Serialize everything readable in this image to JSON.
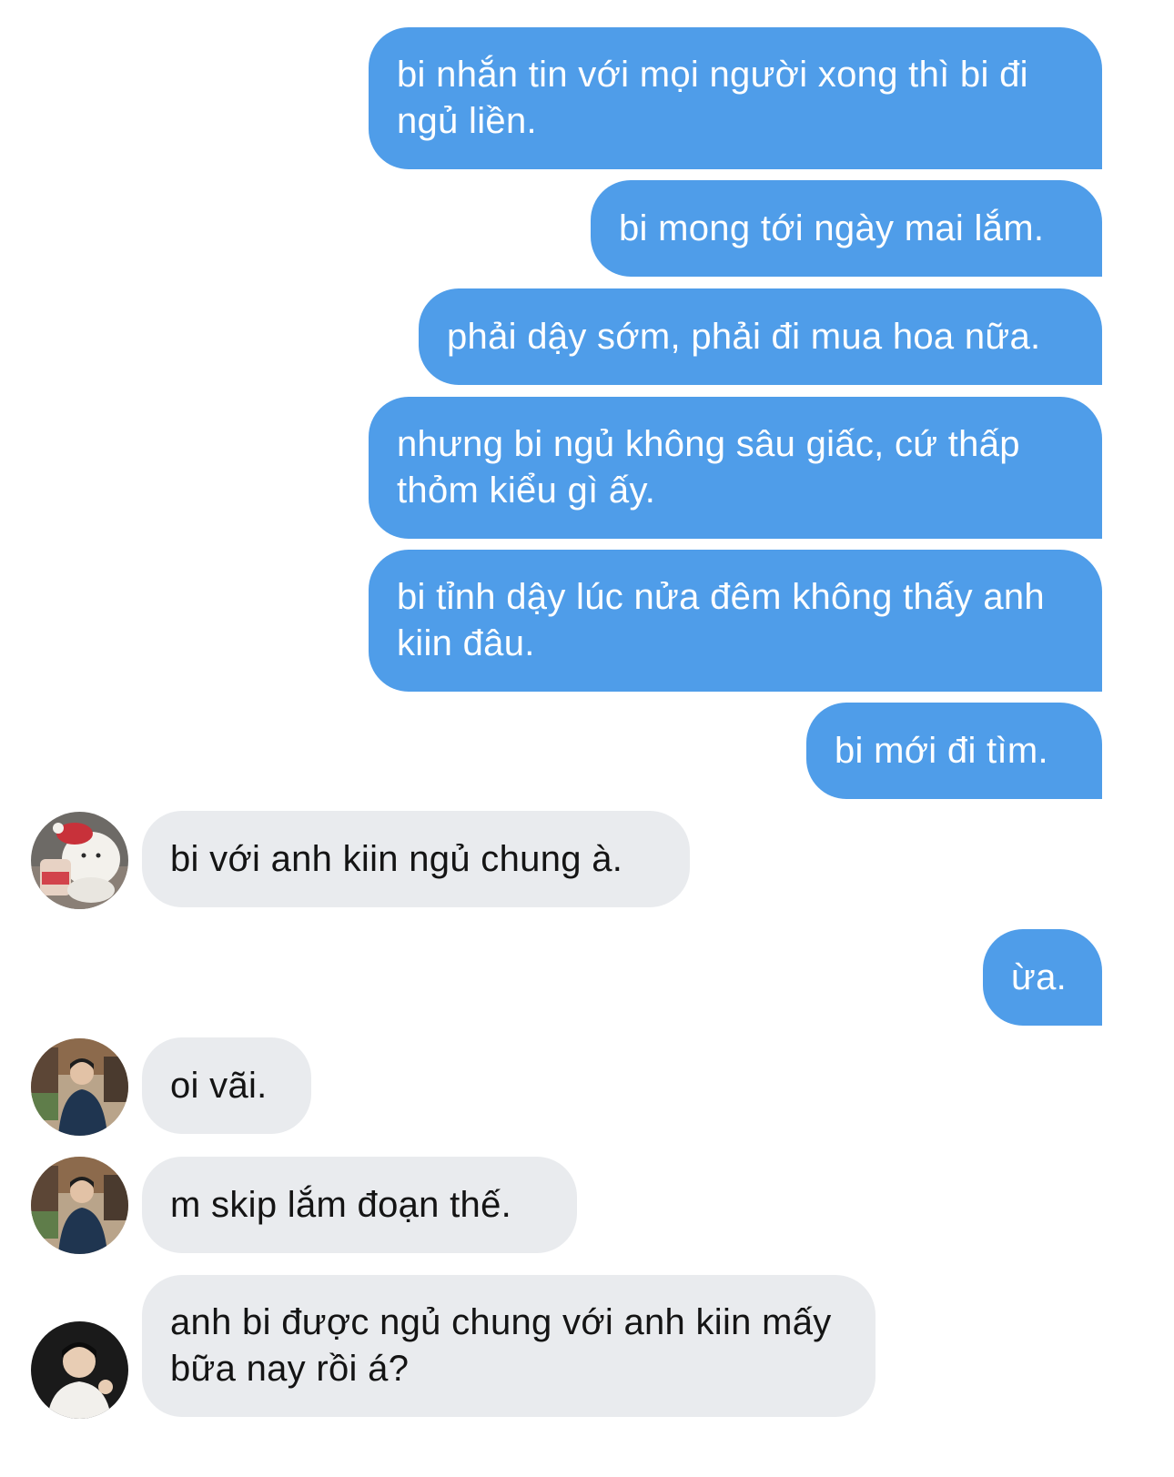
{
  "colors": {
    "outgoing_bubble": "#4f9de9",
    "incoming_bubble": "#e9ebee",
    "outgoing_text": "#ffffff",
    "incoming_text": "#141414"
  },
  "messages": [
    {
      "direction": "outgoing",
      "text": "bi nhắn tin với mọi người xong thì bi đi ngủ liền."
    },
    {
      "direction": "outgoing",
      "text": "bi mong tới ngày mai lắm."
    },
    {
      "direction": "outgoing",
      "text": "phải dậy sớm, phải đi mua hoa nữa."
    },
    {
      "direction": "outgoing",
      "text": "nhưng bi ngủ không sâu giấc, cứ thấp thỏm kiểu gì ấy."
    },
    {
      "direction": "outgoing",
      "text": "bi tỉnh dậy lúc nửa đêm không thấy anh kiin đâu."
    },
    {
      "direction": "outgoing",
      "text": "bi mới đi tìm."
    },
    {
      "direction": "incoming",
      "avatar": "bear-avatar",
      "text": "bi với anh kiin ngủ chung à."
    },
    {
      "direction": "outgoing",
      "text": "ừa."
    },
    {
      "direction": "incoming",
      "avatar": "man-street-avatar",
      "text": "oi vãi."
    },
    {
      "direction": "incoming",
      "avatar": "man-street-avatar",
      "text": "m skip lắm đoạn thế."
    },
    {
      "direction": "incoming",
      "avatar": "man-selfie-avatar",
      "text": "anh bi được ngủ chung với anh kiin mấy bữa nay rồi á?"
    }
  ]
}
